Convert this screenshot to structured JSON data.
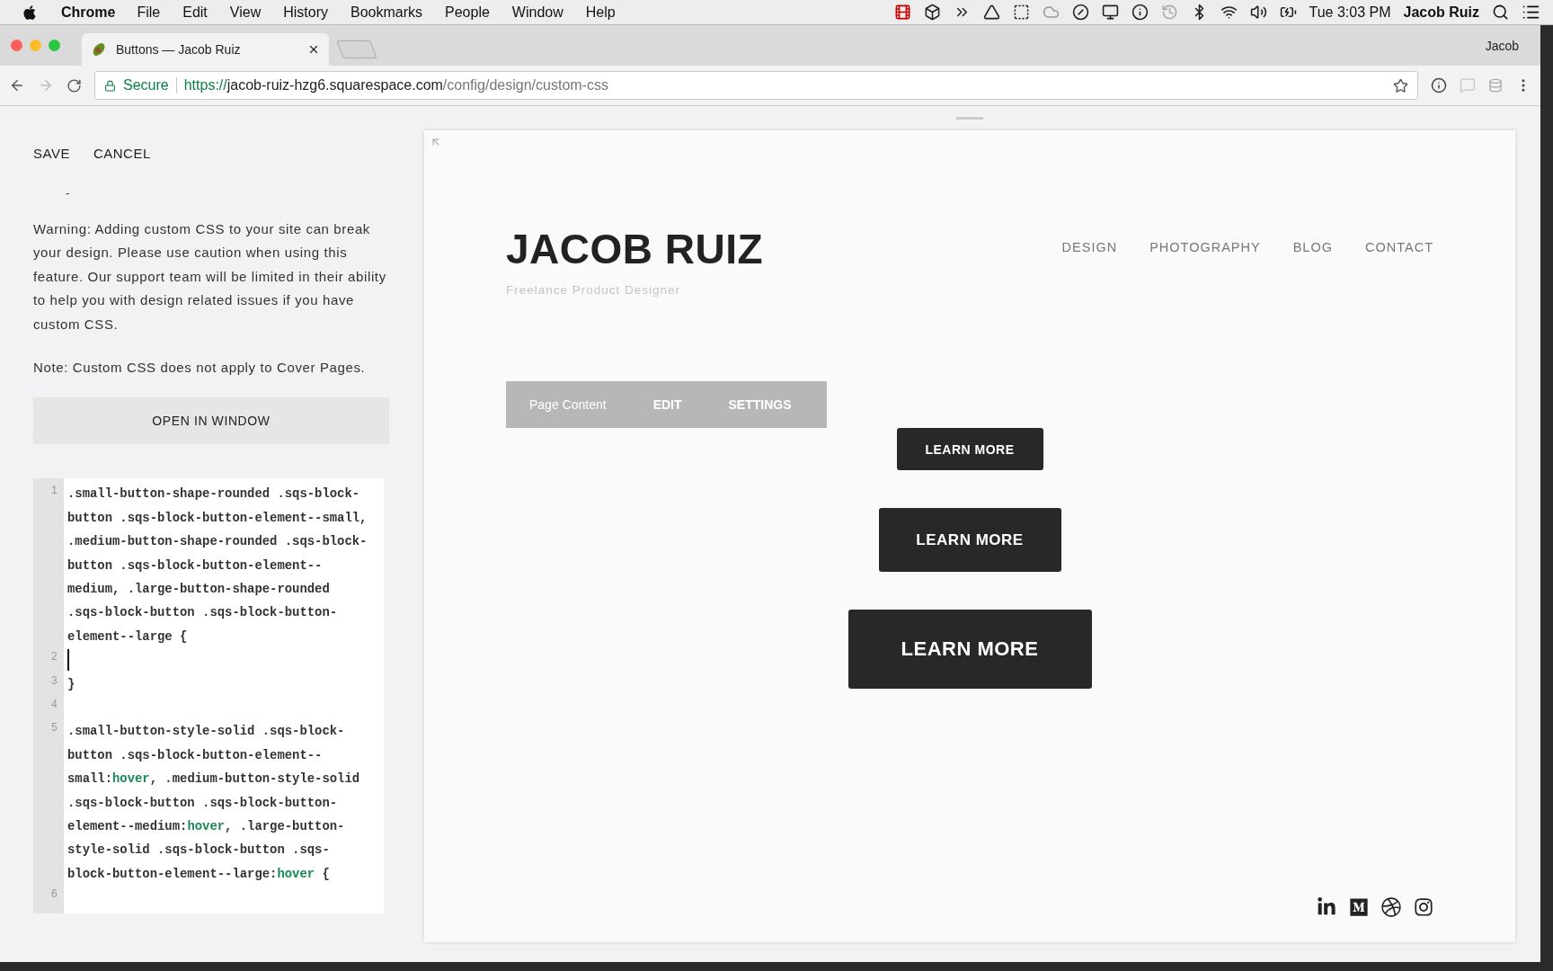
{
  "menu_bar": {
    "app": "Chrome",
    "items": [
      "File",
      "Edit",
      "View",
      "History",
      "Bookmarks",
      "People",
      "Window",
      "Help"
    ],
    "clock": "Tue 3:03 PM",
    "user": "Jacob Ruiz"
  },
  "browser": {
    "tabs": [
      {
        "title": "Buttons — Jacob Ruiz",
        "selected": true
      }
    ],
    "profile": "Jacob",
    "security": "Secure",
    "url": {
      "scheme": "https://",
      "host": "jacob-ruiz-hzg6.squarespace.com",
      "path": "/config/design/custom-css"
    }
  },
  "editor_panel": {
    "actions": [
      "SAVE",
      "CANCEL"
    ],
    "mark": "-",
    "warning": "Warning: Adding custom CSS to your site can break your design. Please use caution when using this feature. Our support team will be limited in their ability to help you with design related issues if you have custom CSS.",
    "note": "Note: Custom CSS does not apply to Cover Pages.",
    "open_button": "OPEN IN WINDOW",
    "code_rows": [
      {
        "number": "1",
        "text": ".small-button-shape-rounded .sqs-block-",
        "cursor": false
      },
      {
        "text": "button .sqs-block-button-element--small,",
        "cursor": false
      },
      {
        "text": ".medium-button-shape-rounded .sqs-block-",
        "cursor": false
      },
      {
        "text": "button .sqs-block-button-element--",
        "cursor": false
      },
      {
        "text": "medium, .large-button-shape-rounded",
        "cursor": false
      },
      {
        "text": ".sqs-block-button .sqs-block-button-",
        "cursor": false
      },
      {
        "text": "element--large {",
        "cursor": false
      },
      {
        "number": "2",
        "cursor": true
      },
      {
        "number": "3",
        "text": "}",
        "cursor": false
      },
      {
        "number": "4",
        "cursor": false
      },
      {
        "number": "5",
        "text": ".small-button-style-solid .sqs-block-",
        "cursor": false
      },
      {
        "text": "button .sqs-block-button-element--",
        "cursor": false
      },
      {
        "text": "small:",
        "keyword": "hover",
        "rest": ", .medium-button-style-solid",
        "cursor": false
      },
      {
        "text": ".sqs-block-button .sqs-block-button-",
        "cursor": false
      },
      {
        "text": "element--medium:",
        "keyword": "hover",
        "rest": ", .large-button-",
        "cursor": false
      },
      {
        "text": "style-solid .sqs-block-button .sqs-",
        "cursor": false
      },
      {
        "text": "block-button-element--large:",
        "keyword": "hover",
        "rest": " {",
        "cursor": false
      },
      {
        "number": "6",
        "cursor": false
      }
    ]
  },
  "preview": {
    "site_title": "JACOB RUIZ",
    "tagline": "Freelance Product Designer",
    "nav": [
      "DESIGN",
      "PHOTOGRAPHY",
      "BLOG",
      "CONTACT"
    ],
    "page_toolbar": [
      {
        "label": "Page Content",
        "kind": "title"
      },
      {
        "label": "EDIT",
        "kind": "action"
      },
      {
        "label": "SETTINGS",
        "kind": "action"
      }
    ],
    "buttons": [
      {
        "label": "LEARN MORE",
        "kind": "small"
      },
      {
        "label": "LEARN MORE",
        "kind": "medium"
      },
      {
        "label": "LEARN MORE",
        "kind": "large"
      }
    ]
  }
}
